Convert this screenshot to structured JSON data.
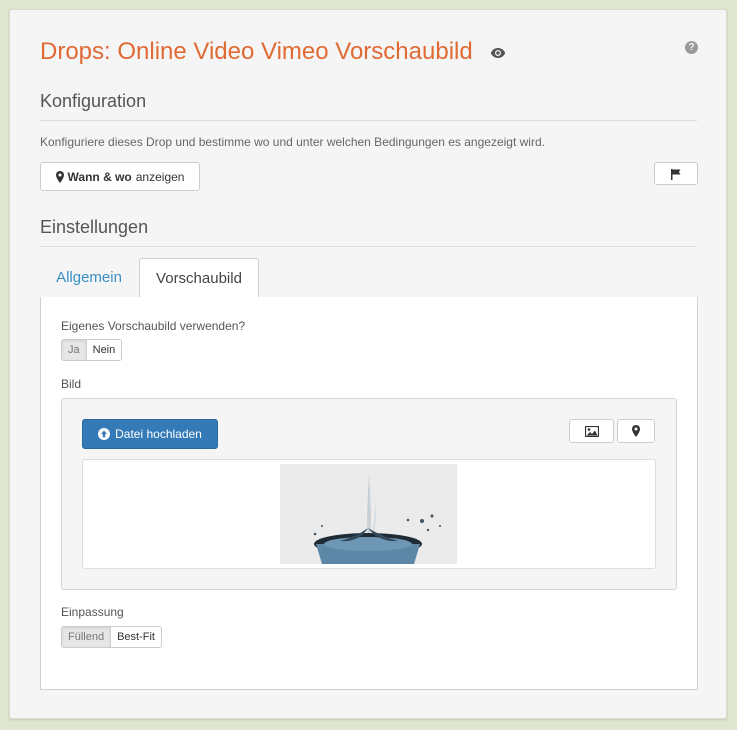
{
  "header": {
    "title": "Drops: Online Video Vimeo Vorschaubild",
    "help_glyph": "?"
  },
  "konfiguration": {
    "heading": "Konfiguration",
    "description": "Konfiguriere dieses Drop und bestimme wo und unter welchen Bedingungen es angezeigt wird.",
    "when_where_bold": "Wann & wo",
    "when_where_rest": "anzeigen"
  },
  "einstellungen": {
    "heading": "Einstellungen",
    "tabs": [
      {
        "label": "Allgemein",
        "active": false
      },
      {
        "label": "Vorschaubild",
        "active": true
      }
    ]
  },
  "vorschaubild": {
    "own_thumbnail_label": "Eigenes Vorschaubild verwenden?",
    "own_thumbnail_options": [
      "Ja",
      "Nein"
    ],
    "own_thumbnail_selected": "Ja",
    "bild_label": "Bild",
    "upload_label": "Datei hochladen",
    "fit_label": "Einpassung",
    "fit_options": [
      "Füllend",
      "Best-Fit"
    ],
    "fit_selected": "Füllend"
  },
  "colors": {
    "title_accent": "#e06a34",
    "link": "#3a8fc5",
    "primary_button": "#337ab7",
    "background": "#dfe5d0"
  },
  "icons": {
    "visibility": "eye-icon",
    "help": "question-circle-icon",
    "location": "map-marker-icon",
    "flag": "flag-icon",
    "upload": "upload-circle-icon",
    "image": "image-icon"
  }
}
